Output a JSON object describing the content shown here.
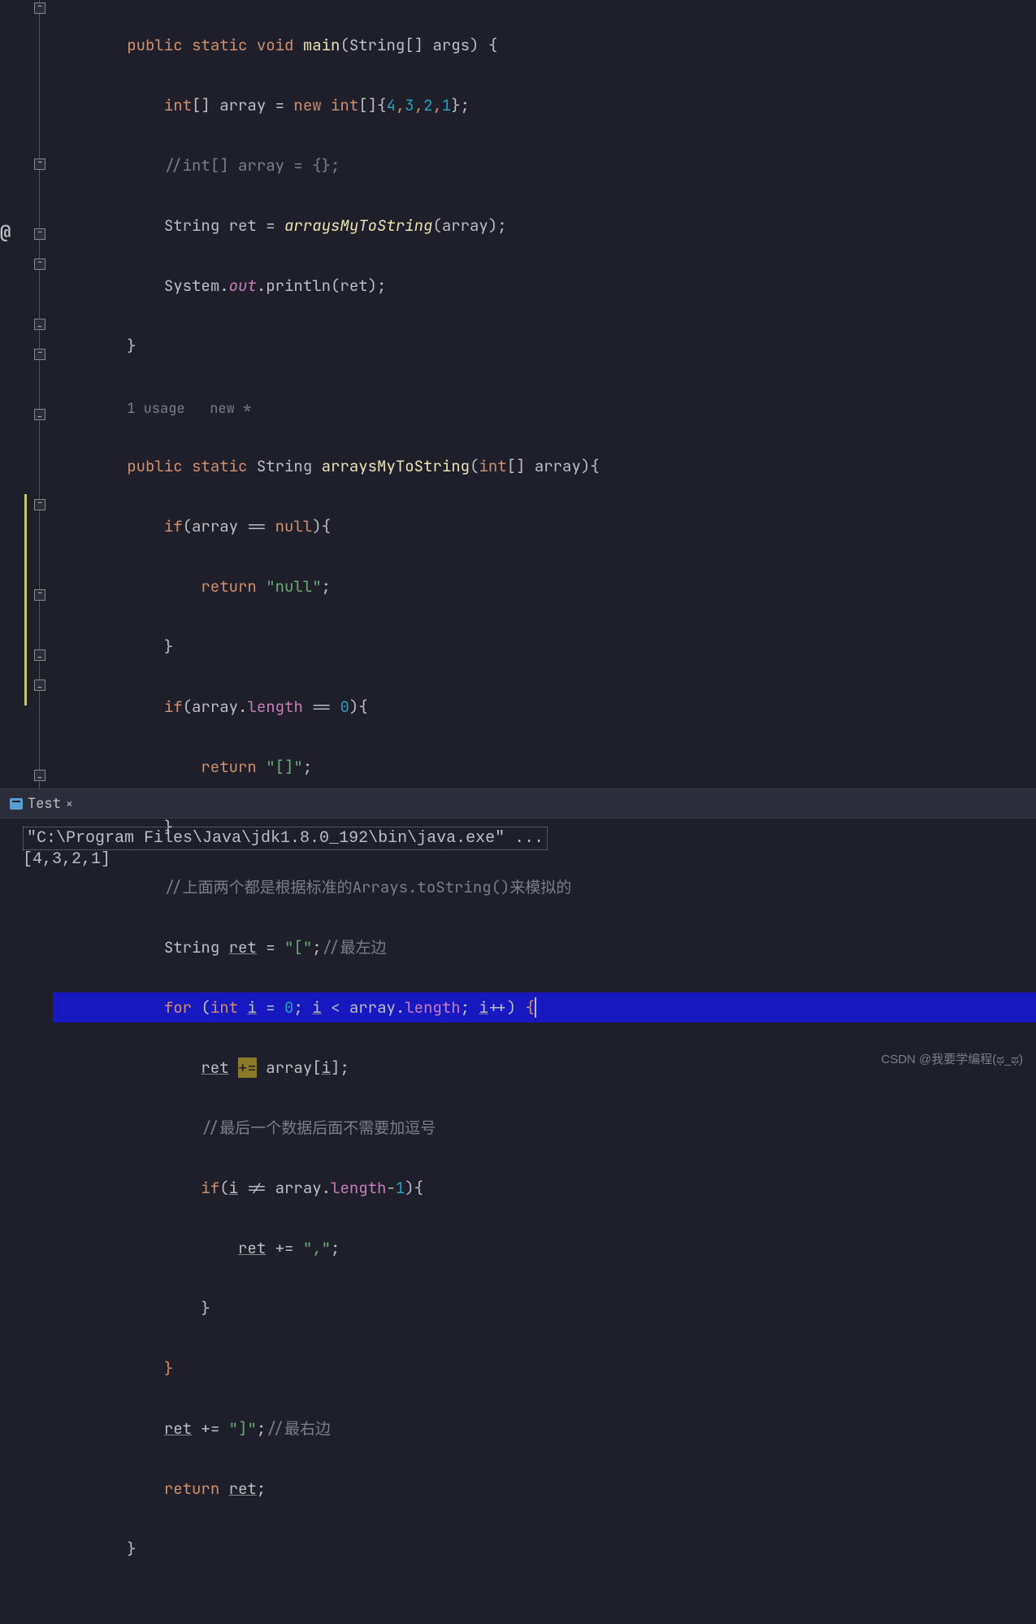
{
  "editor": {
    "annotations": {
      "usage_hint": "1 usage   new *",
      "at_marker": "@"
    },
    "lines": {
      "l0_ind": "        ",
      "l0_kw1": "public",
      "l0_sp1": " ",
      "l0_kw2": "static",
      "l0_sp2": " ",
      "l0_kw3": "void",
      "l0_sp3": " ",
      "l0_method": "main",
      "l0_par": "(String[] args) {",
      "l1_ind": "            ",
      "l1_kw": "int",
      "l1_t1": "[] array = ",
      "l1_kw2": "new int",
      "l1_t2": "[]{",
      "l1_n1": "4",
      "l1_c1": ",",
      "l1_n2": "3",
      "l1_c2": ",",
      "l1_n3": "2",
      "l1_c3": ",",
      "l1_n4": "1",
      "l1_t3": "};",
      "l2_ind": "            ",
      "l2_txt": "//int[] array = {};",
      "l3_ind": "            ",
      "l3_t1": "String ret = ",
      "l3_m": "arraysMyToString",
      "l3_t2": "(array);",
      "l4_ind": "            ",
      "l4_t1": "System.",
      "l4_f": "out",
      "l4_t2": ".println(ret);",
      "l5_ind": "        ",
      "l5_txt": "}",
      "l6_ind": "        ",
      "l7_ind": "        ",
      "l7_kw1": "public",
      "l7_sp1": " ",
      "l7_kw2": "static",
      "l7_sp2": " ",
      "l7_type": "String ",
      "l7_m": "arraysMyToString",
      "l7_op": "(",
      "l7_kw3": "int",
      "l7_t2": "[] array){",
      "l8_ind": "            ",
      "l8_kw": "if",
      "l8_t1": "(array == ",
      "l8_kw2": "null",
      "l8_t2": "){",
      "l9_ind": "                ",
      "l9_kw": "return",
      "l9_sp": " ",
      "l9_str": "\"null\"",
      "l9_sc": ";",
      "l10_ind": "            ",
      "l10_txt": "}",
      "l11_ind": "            ",
      "l11_kw": "if",
      "l11_t1": "(array.",
      "l11_f": "length",
      "l11_t2": " == ",
      "l11_n": "0",
      "l11_t3": "){",
      "l12_ind": "                ",
      "l12_kw": "return",
      "l12_sp": " ",
      "l12_str": "\"[]\"",
      "l12_sc": ";",
      "l13_ind": "            ",
      "l13_txt": "}",
      "l14_ind": "            ",
      "l14_txt": "//上面两个都是根据标准的Arrays.toString()来模拟的",
      "l15_ind": "            ",
      "l15_t1": "String ",
      "l15_v": "ret",
      "l15_t2": " = ",
      "l15_str": "\"[\"",
      "l15_sc": ";",
      "l15_cm": "//最左边",
      "l16_ind": "            ",
      "l16_kw": "for",
      "l16_t1": " (",
      "l16_kw2": "int",
      "l16_sp": " ",
      "l16_v1": "i",
      "l16_t2": " = ",
      "l16_n": "0",
      "l16_t3": "; ",
      "l16_v2": "i",
      "l16_t4": " < array.",
      "l16_f": "length",
      "l16_t5": "; ",
      "l16_v3": "i",
      "l16_t6": "++) ",
      "l16_br": "{",
      "l17_ind": "                ",
      "l17_v": "ret",
      "l17_sp": " ",
      "l17_op": "+=",
      "l17_sp2": " ",
      "l17_t1": "array[",
      "l17_v2": "i",
      "l17_t2": "];",
      "l18_ind": "                ",
      "l18_txt": "//最后一个数据后面不需要加逗号",
      "l19_ind": "                ",
      "l19_kw": "if",
      "l19_t1": "(",
      "l19_v": "i",
      "l19_t2": " != array.",
      "l19_f": "length",
      "l19_t3": "-",
      "l19_n": "1",
      "l19_t4": "){",
      "l20_ind": "                    ",
      "l20_v": "ret",
      "l20_t1": " += ",
      "l20_str": "\",\"",
      "l20_sc": ";",
      "l21_ind": "                ",
      "l21_txt": "}",
      "l22_ind": "            ",
      "l22_txt": "}",
      "l23_ind": "            ",
      "l23_v": "ret",
      "l23_t1": " += ",
      "l23_str": "\"]\"",
      "l23_sc": ";",
      "l23_cm": "//最右边",
      "l24_ind": "            ",
      "l24_kw": "return",
      "l24_sp": " ",
      "l24_v": "ret",
      "l24_sc": ";",
      "l25_ind": "        ",
      "l25_txt": "}"
    }
  },
  "terminal": {
    "tab_name": "Test",
    "command": "\"C:\\Program Files\\Java\\jdk1.8.0_192\\bin\\java.exe\" ...",
    "output": "[4,3,2,1]"
  },
  "watermark": "CSDN @我要学编程(ಥ_ಥ)"
}
